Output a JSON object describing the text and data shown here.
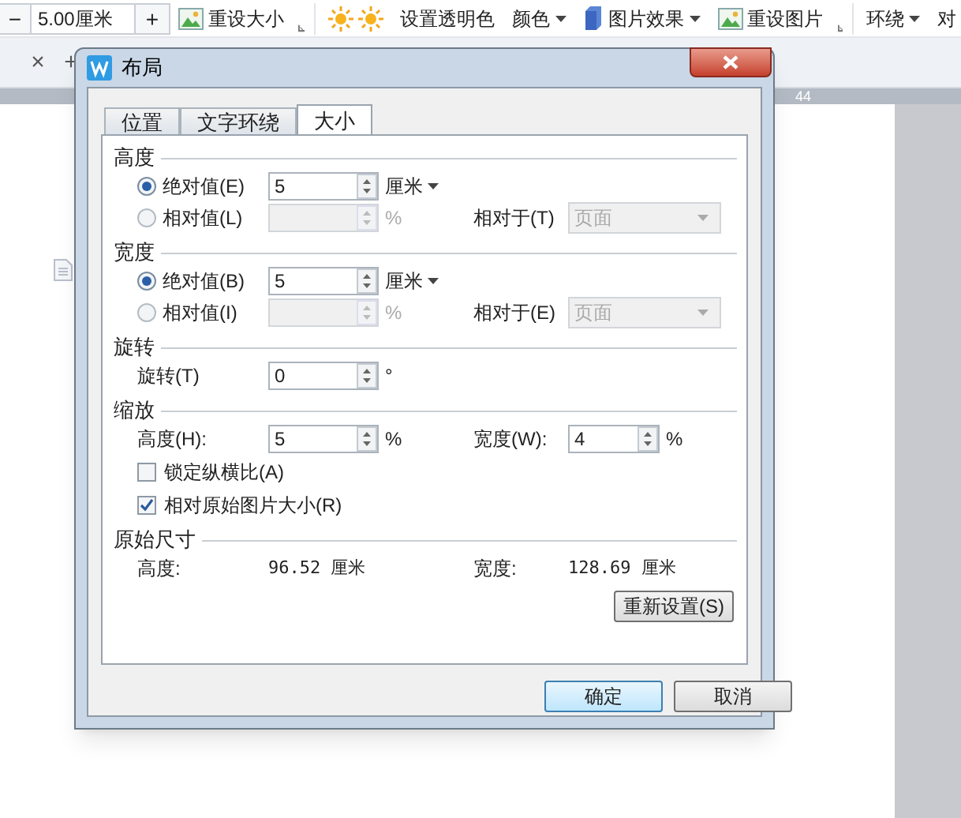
{
  "toolbar": {
    "size_field": {
      "minus": "−",
      "value": "5.00厘米",
      "plus": "+"
    },
    "items": [
      {
        "kind": "image",
        "label": "重设大小",
        "launcher": true
      },
      {
        "kind": "brightness"
      },
      {
        "kind": "plain",
        "label": "设置透明色"
      },
      {
        "kind": "menu",
        "label": "颜色"
      },
      {
        "kind": "effects",
        "label": "图片效果",
        "menu": true
      },
      {
        "kind": "image",
        "label": "重设图片",
        "launcher": true
      },
      {
        "kind": "menu",
        "label": "环绕"
      },
      {
        "kind": "plain",
        "label": "对"
      }
    ]
  },
  "doc_tabs": {
    "close": "×",
    "add": "+"
  },
  "ruler": {
    "mark": "44"
  },
  "dialog": {
    "title": "布局",
    "tabs": [
      {
        "label": "位置",
        "selected": false
      },
      {
        "label": "文字环绕",
        "selected": false
      },
      {
        "label": "大小",
        "selected": true
      }
    ],
    "sections": [
      {
        "title": "高度",
        "rows": [
          {
            "kind": "radio",
            "label": "绝对值(E)",
            "selected": true,
            "value": "5",
            "unit": "厘米",
            "unit_menu": true
          },
          {
            "kind": "radio",
            "label": "相对值(L)",
            "selected": false,
            "disabled": true,
            "unit": "%",
            "pair": {
              "kind": "select",
              "label": "相对于(T)",
              "value": "页面",
              "disabled": true
            }
          }
        ]
      },
      {
        "title": "宽度",
        "rows": [
          {
            "kind": "radio",
            "label": "绝对值(B)",
            "selected": true,
            "value": "5",
            "unit": "厘米",
            "unit_menu": true
          },
          {
            "kind": "radio",
            "label": "相对值(I)",
            "selected": false,
            "disabled": true,
            "unit": "%",
            "pair": {
              "kind": "select",
              "label": "相对于(E)",
              "value": "页面",
              "disabled": true
            }
          }
        ]
      },
      {
        "title": "旋转",
        "rows": [
          {
            "kind": "field",
            "label": "旋转(T)",
            "value": "0",
            "unit": "°"
          }
        ]
      },
      {
        "title": "缩放",
        "rows": [
          {
            "kind": "field",
            "label": "高度(H):",
            "value": "5",
            "unit": "%",
            "pair": {
              "kind": "spin",
              "label": "宽度(W):",
              "value": "4",
              "unit": "%"
            }
          },
          {
            "kind": "checkbox",
            "label": "锁定纵横比(A)",
            "checked": false
          },
          {
            "kind": "checkbox",
            "label": "相对原始图片大小(R)",
            "checked": true
          }
        ]
      },
      {
        "title": "原始尺寸",
        "rows": [
          {
            "kind": "info",
            "label": "高度:",
            "value": "96.52 厘米",
            "pair": {
              "kind": "info",
              "label": "宽度:",
              "value": "128.69 厘米"
            }
          }
        ]
      }
    ],
    "reset_button": "重新设置(S)",
    "buttons": [
      {
        "label": "确定",
        "default": true
      },
      {
        "label": "取消",
        "default": false
      }
    ]
  }
}
